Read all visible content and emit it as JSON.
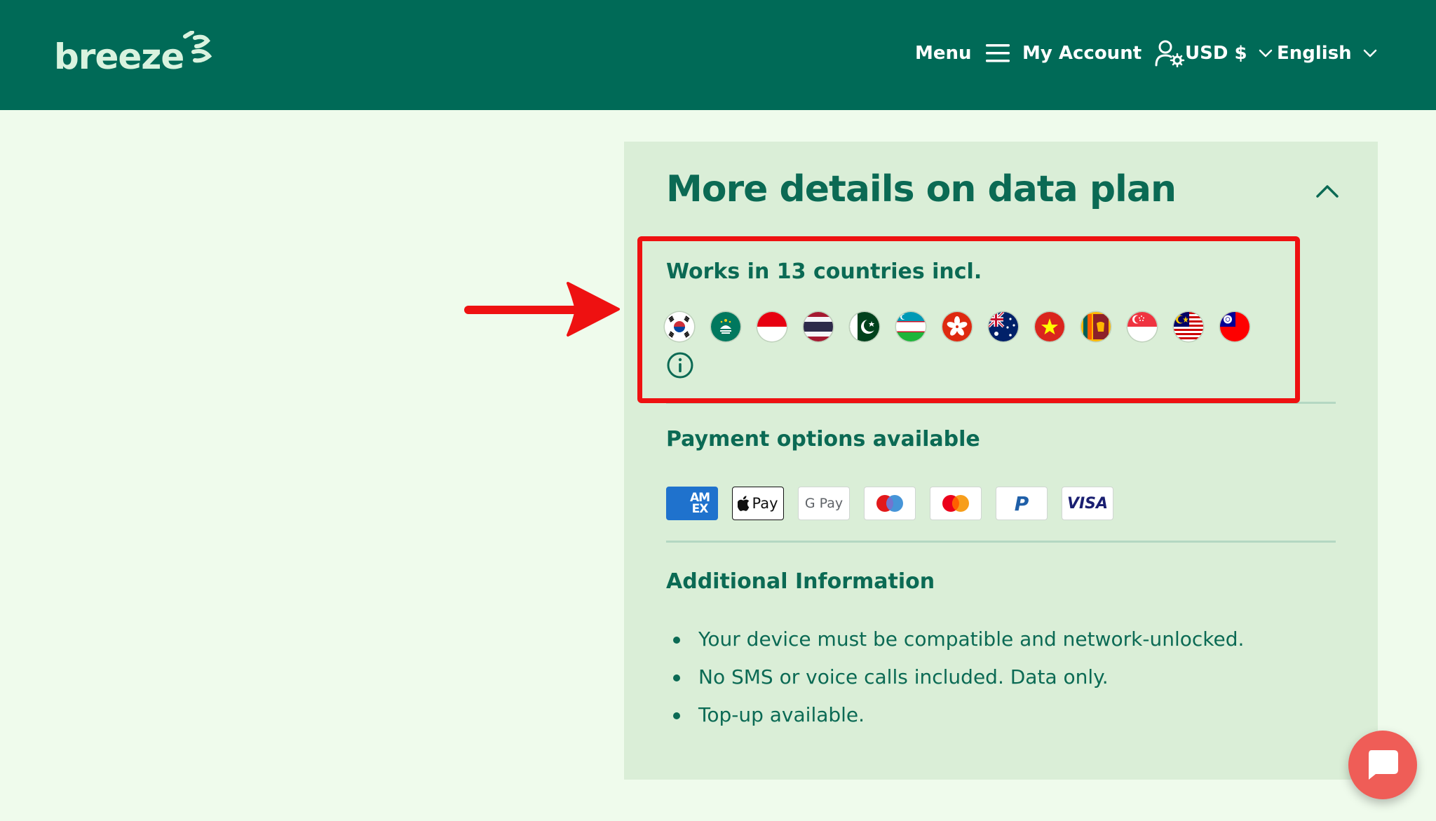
{
  "brand": {
    "logo_text": "breeze"
  },
  "nav": {
    "menu_label": "Menu",
    "account_label": "My Account",
    "currency_label": "USD $",
    "language_label": "English"
  },
  "card": {
    "title": "More details on data plan",
    "countries_title": "Works in 13 countries incl.",
    "flags": [
      "south-korea-flag-icon",
      "macau-flag-icon",
      "indonesia-flag-icon",
      "thailand-flag-icon",
      "pakistan-flag-icon",
      "uzbekistan-flag-icon",
      "hong-kong-flag-icon",
      "australia-flag-icon",
      "vietnam-flag-icon",
      "sri-lanka-flag-icon",
      "singapore-flag-icon",
      "malaysia-flag-icon",
      "taiwan-flag-icon"
    ],
    "payment_title": "Payment options available",
    "payments": {
      "amex": "AM EX",
      "applepay": "Pay",
      "googlepay": "G Pay",
      "maestro": "maestro-icon",
      "mastercard": "mastercard-icon",
      "paypal": "P",
      "visa": "VISA"
    },
    "info_title": "Additional Information",
    "info_items": [
      "Your device must be compatible and network-unlocked.",
      "No SMS or voice calls included. Data only.",
      "Top-up available."
    ]
  },
  "colors": {
    "header": "#006a57",
    "page_bg": "#effbec",
    "card_bg": "#daeed7",
    "text": "#0b6a54",
    "annotation": "#ee1111",
    "chat": "#ef5d57"
  }
}
